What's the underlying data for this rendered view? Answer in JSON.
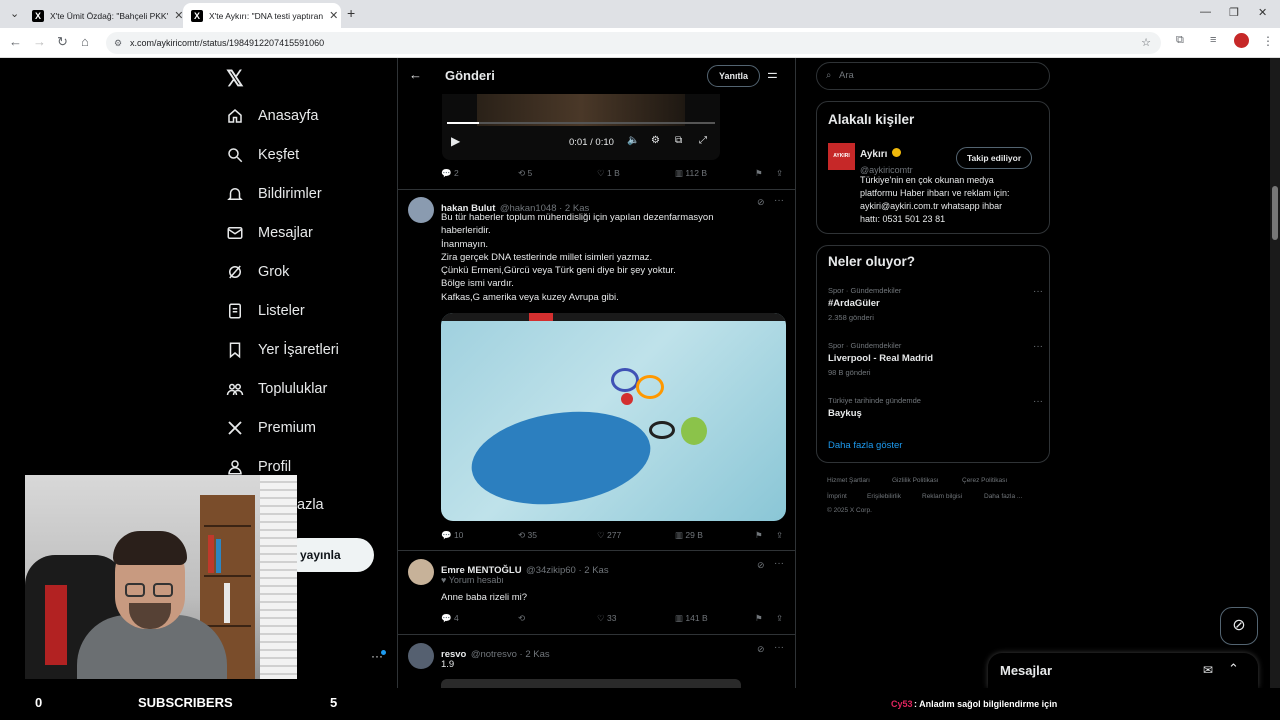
{
  "browser": {
    "tabs": [
      {
        "title": "X'te Ümit Özdağ: \"Bahçeli PKK'"
      },
      {
        "title": "X'te Aykırı: \"DNA testi yaptıran"
      }
    ],
    "url": "x.com/aykiricomtr/status/1984912207415591060"
  },
  "nav": {
    "items": [
      {
        "label": "Anasayfa",
        "icon": "home-icon"
      },
      {
        "label": "Keşfet",
        "icon": "search-icon"
      },
      {
        "label": "Bildirimler",
        "icon": "bell-icon"
      },
      {
        "label": "Mesajlar",
        "icon": "mail-icon"
      },
      {
        "label": "Grok",
        "icon": "grok-icon"
      },
      {
        "label": "Listeler",
        "icon": "list-icon"
      },
      {
        "label": "Yer İşaretleri",
        "icon": "bookmark-icon"
      },
      {
        "label": "Topluluklar",
        "icon": "community-icon"
      },
      {
        "label": "Premium",
        "icon": "x-icon"
      },
      {
        "label": "Profil",
        "icon": "user-icon"
      },
      {
        "label": "azla",
        "icon": "more-icon"
      }
    ],
    "post_button": "yayınla"
  },
  "header": {
    "title": "Gönderi",
    "reply_button": "Yanıtla"
  },
  "video": {
    "time": "0:01 / 0:10"
  },
  "first_stats": {
    "replies": "2",
    "reposts": "5",
    "likes": "1 B",
    "views": "112 B"
  },
  "posts": [
    {
      "name": "hakan Bulut",
      "handle": "@hakan1048 · 2 Kas",
      "lines": [
        "Bu tür haberler toplum mühendisliği için yapılan dezenfarmasyon",
        "haberleridir.",
        "İnanmayın.",
        "Zira gerçek DNA testlerinde millet isimleri yazmaz.",
        "Çünkü Ermeni,Gürcü veya Türk geni diye bir şey yoktur.",
        "Bölge ismi vardır.",
        "Kafkas,G amerika veya kuzey Avrupa gibi."
      ],
      "stats": {
        "replies": "10",
        "reposts": "35",
        "likes": "277",
        "views": "29 B"
      }
    },
    {
      "name": "Emre MENTOĞLU",
      "handle": "@34zikip60 · 2 Kas",
      "sub": "Yorum hesabı",
      "text": "Anne baba rizeli mi?",
      "stats": {
        "replies": "4",
        "reposts": "",
        "likes": "33",
        "views": "141 B"
      }
    },
    {
      "name": "resvo",
      "handle": "@notresvo · 2 Kas",
      "text": "1.9"
    }
  ],
  "search": {
    "placeholder": "Ara"
  },
  "related": {
    "title": "Alakalı kişiler",
    "name": "Aykırı",
    "handle": "@aykiricomtr",
    "avatar_text": "AYKIRI",
    "follow": "Takip ediliyor",
    "bio": [
      "Türkiye'nin en çok okunan medya",
      "platformu Haber ihbarı ve reklam için:",
      "aykiri@aykiri.com.tr whatsapp ihbar",
      "hattı: 0531 501 23 81"
    ]
  },
  "trends": {
    "title": "Neler oluyor?",
    "items": [
      {
        "cat": "Spor · Gündemdekiler",
        "title": "#ArdaGüler",
        "count": "2.358 gönderi"
      },
      {
        "cat": "Spor · Gündemdekiler",
        "title": "Liverpool - Real Madrid",
        "count": "98 B gönderi"
      },
      {
        "cat": "Türkiye tarihinde gündemde",
        "title": "Baykuş",
        "count": ""
      }
    ],
    "show_more": "Daha fazla göster"
  },
  "footer": {
    "links": [
      "Hizmet Şartları",
      "Gizlilik Politikası",
      "Çerez Politikası",
      "İmprint",
      "Erişilebilirlik",
      "Reklam bilgisi",
      "Daha fazla ..."
    ],
    "copyright": "© 2025 X Corp."
  },
  "messages": {
    "title": "Mesajlar"
  },
  "stream": {
    "left_num": "0",
    "subscribers": "SUBSCRIBERS",
    "right_num": "5",
    "chat_user": "Cy53",
    "chat_msg": ": Anladım sağol bilgilendirme için"
  },
  "colors": {
    "accent": "#1d9bf0",
    "chat_user": "#e0245e",
    "verified": "#f0b90b"
  }
}
